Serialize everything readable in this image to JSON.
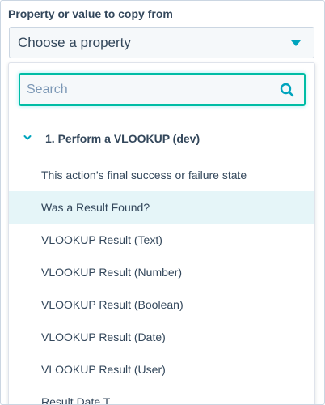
{
  "field": {
    "label": "Property or value to copy from",
    "selected": "Choose a property"
  },
  "search": {
    "placeholder": "Search",
    "value": ""
  },
  "group": {
    "label": "1. Perform a VLOOKUP (dev)"
  },
  "options": [
    "This action’s final success or failure state",
    "Was a Result Found?",
    "VLOOKUP Result (Text)",
    "VLOOKUP Result (Number)",
    "VLOOKUP Result (Boolean)",
    "VLOOKUP Result (Date)",
    "VLOOKUP Result (User)",
    "Result Date T..."
  ],
  "hovered_option_index": 1,
  "colors": {
    "accent": "#00a4bd",
    "focus_border": "#00bda5",
    "hover_bg": "#e5f5f8",
    "text": "#33475b"
  }
}
